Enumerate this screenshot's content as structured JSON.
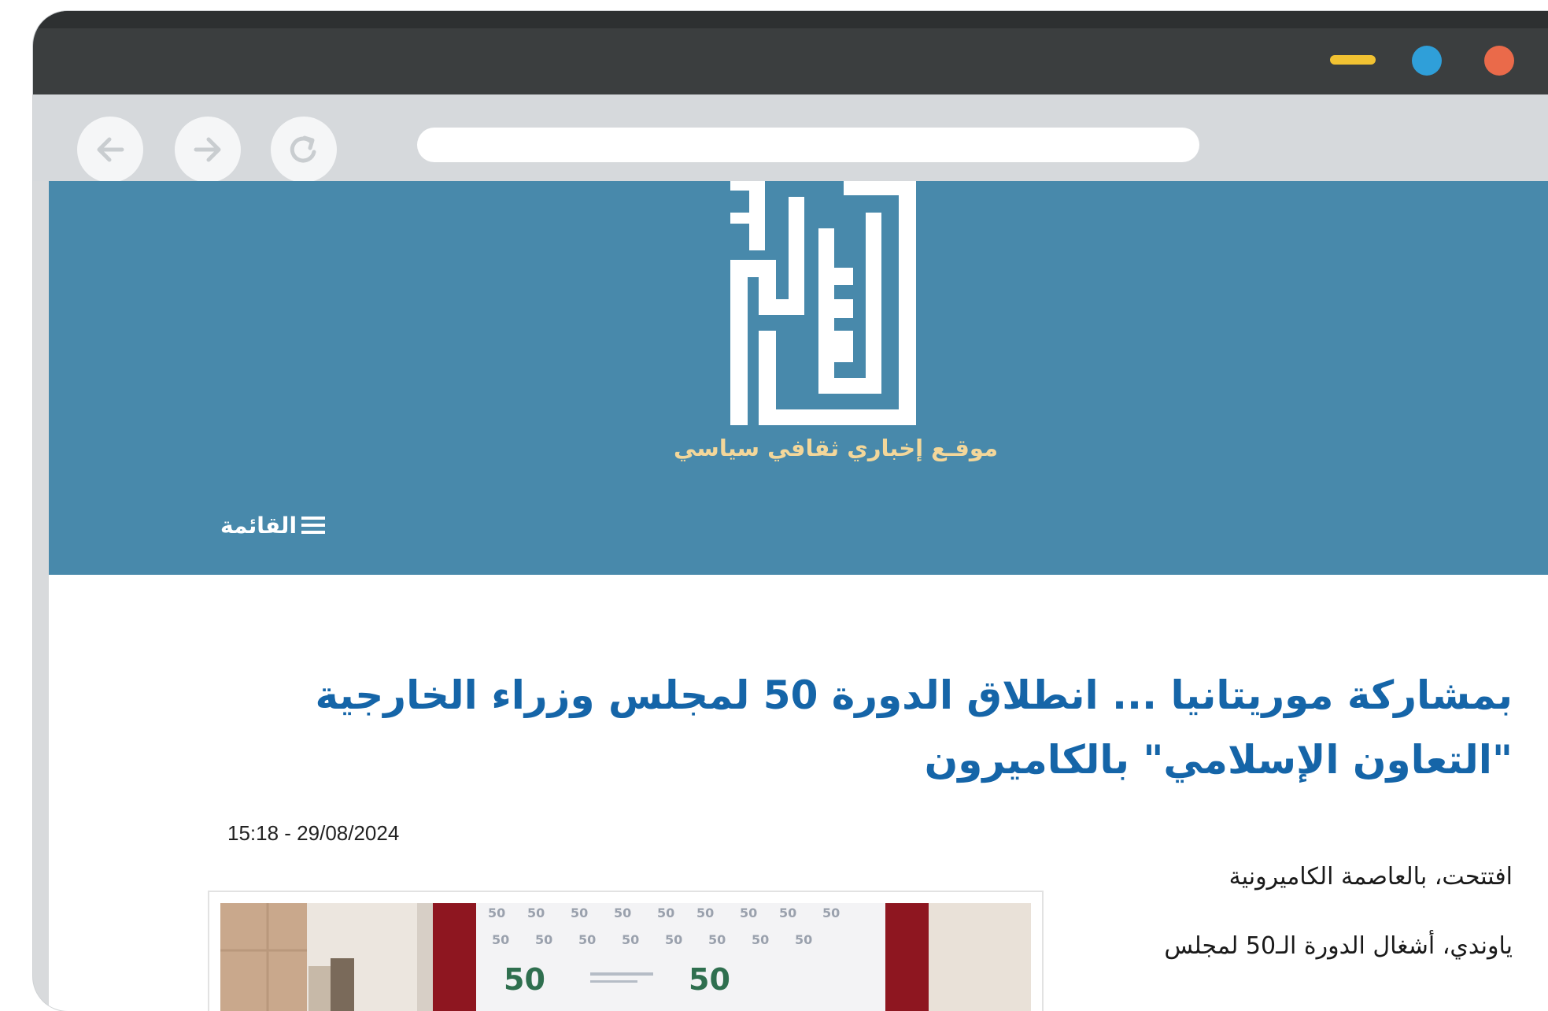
{
  "header": {
    "tagline": "موقـع إخباري ثقافي سياسي",
    "menu_label": "القائمة"
  },
  "article": {
    "title_line1": "بمشاركة موريتانيا ... انطلاق الدورة 50 لمجلس وزراء الخارجية",
    "title_line2": "\"التعاون الإسلامي\" بالكاميرون",
    "datetime": "15:18 - 29/08/2024",
    "paragraphs": [
      "افتتحت، بالعاصمة الكاميرونية",
      "ياوندي، أشغال الدورة الـ50 لمجلس"
    ]
  },
  "colors": {
    "header_bg": "#4889ab",
    "title": "#1565a8",
    "tagline": "#f3d79a",
    "close_dot": "#ea6a4a",
    "maximize_dot": "#2f9fd9",
    "minimize_dot": "#f1c232"
  },
  "icons": [
    "back-arrow-icon",
    "forward-arrow-icon",
    "reload-icon",
    "hamburger-menu-icon",
    "site-logo"
  ]
}
